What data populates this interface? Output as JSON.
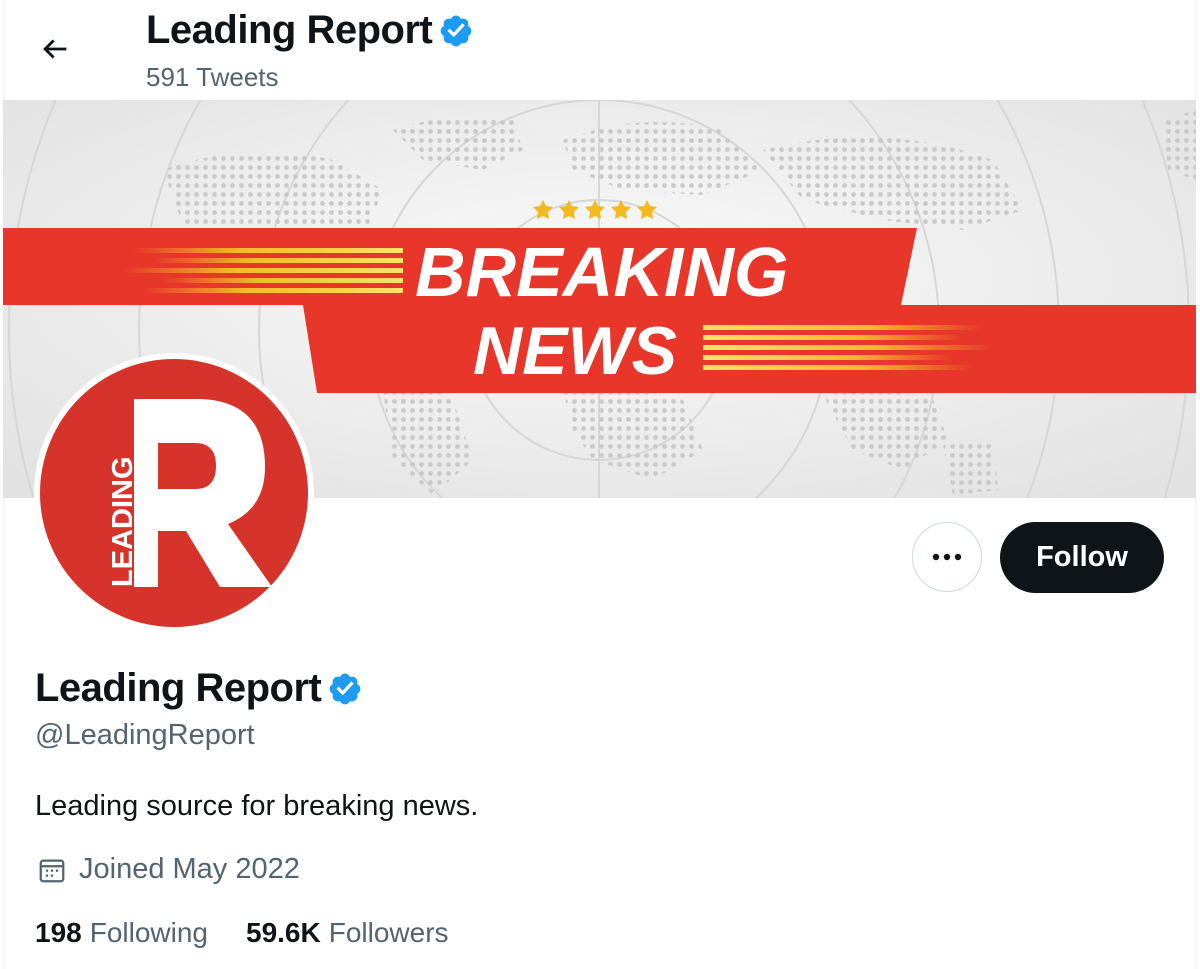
{
  "header": {
    "name": "Leading Report",
    "tweet_count": "591 Tweets"
  },
  "banner": {
    "line1": "BREAKING",
    "line2": "NEWS"
  },
  "avatar": {
    "logo_text": "LEADING",
    "logo_letter": "R"
  },
  "actions": {
    "follow_label": "Follow"
  },
  "profile": {
    "name": "Leading Report",
    "handle": "@LeadingReport",
    "bio": "Leading source for breaking news.",
    "joined": "Joined May 2022",
    "following_count": "198",
    "following_label": "Following",
    "followers_count": "59.6K",
    "followers_label": "Followers"
  },
  "colors": {
    "brand_red": "#d6332a",
    "banner_red": "#e8362a",
    "verified_blue": "#1d9bf0",
    "text_primary": "#0f1419",
    "text_secondary": "#536471"
  },
  "icons": [
    "back-arrow-icon",
    "verified-badge-icon",
    "more-dots-icon",
    "calendar-icon",
    "star-icon"
  ]
}
